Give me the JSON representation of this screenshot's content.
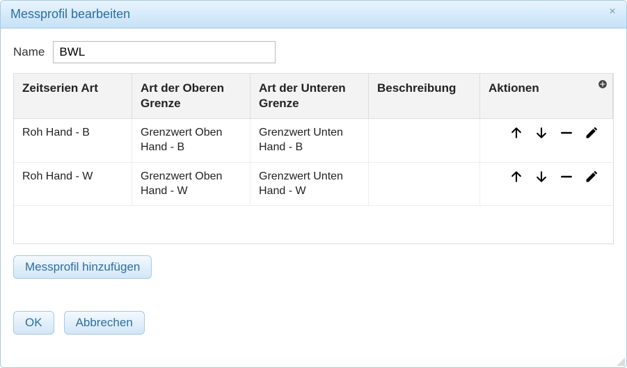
{
  "dialog": {
    "title": "Messprofil bearbeiten",
    "close_symbol": "×"
  },
  "form": {
    "name_label": "Name",
    "name_value": "BWL"
  },
  "table": {
    "headers": {
      "art": "Zeitserien Art",
      "obere": "Art der Oberen Grenze",
      "untere": "Art der Unteren Grenze",
      "beschreibung": "Beschreibung",
      "aktionen": "Aktionen"
    },
    "rows": [
      {
        "art": "Roh Hand - B",
        "obere": "Grenzwert Oben Hand - B",
        "untere": "Grenzwert Unten Hand - B",
        "beschreibung": ""
      },
      {
        "art": "Roh Hand - W",
        "obere": "Grenzwert Oben Hand - W",
        "untere": "Grenzwert Unten Hand - W",
        "beschreibung": ""
      }
    ]
  },
  "buttons": {
    "add_messprofil": "Messprofil hinzufügen",
    "ok": "OK",
    "cancel": "Abbrechen"
  },
  "icons": {
    "add": "add-icon",
    "up": "arrow-up-icon",
    "down": "arrow-down-icon",
    "remove": "minus-icon",
    "edit": "pencil-icon"
  }
}
